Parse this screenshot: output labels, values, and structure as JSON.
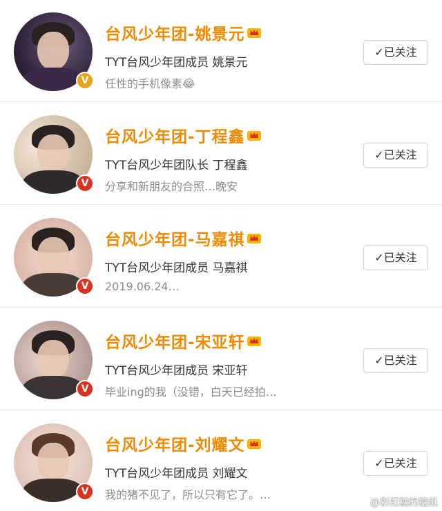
{
  "colors": {
    "name": "#f08a00",
    "subtitle": "#333333",
    "bio": "#8c8c8c",
    "verified_gold": "#e8a317",
    "verified_red": "#d9331f",
    "button_border": "#cfcfcf"
  },
  "icons": {
    "crown": "crown-icon",
    "check": "check-icon",
    "verified": "verified-v-icon",
    "weibo": "weibo-logo-icon"
  },
  "users": [
    {
      "name": "台风少年团-姚景元",
      "subtitle": "TYT台风少年团成员 姚景元",
      "bio": "任性的手机像素😂",
      "badge": "V",
      "badge_color": "gold",
      "button": "✓已关注"
    },
    {
      "name": "台风少年团-丁程鑫",
      "subtitle": "TYT台风少年团队长 丁程鑫",
      "bio": "分享和新朋友的合照…晚安",
      "badge": "V",
      "badge_color": "red",
      "button": "✓已关注"
    },
    {
      "name": "台风少年团-马嘉祺",
      "subtitle": "TYT台风少年团成员 马嘉祺",
      "bio": "2019.06.24…",
      "badge": "V",
      "badge_color": "red",
      "button": "✓已关注"
    },
    {
      "name": "台风少年团-宋亚轩",
      "subtitle": "TYT台风少年团成员 宋亚轩",
      "bio": "毕业ing的我（没错，白天已经拍…",
      "badge": "V",
      "badge_color": "red",
      "button": "✓已关注"
    },
    {
      "name": "台风少年团-刘耀文",
      "subtitle": "TYT台风少年团成员 刘耀文",
      "bio": "我的猪不见了，所以只有它了。…",
      "badge": "V",
      "badge_color": "red",
      "button": "✓已关注"
    }
  ],
  "watermark": "@彩虹糖的糖纸"
}
